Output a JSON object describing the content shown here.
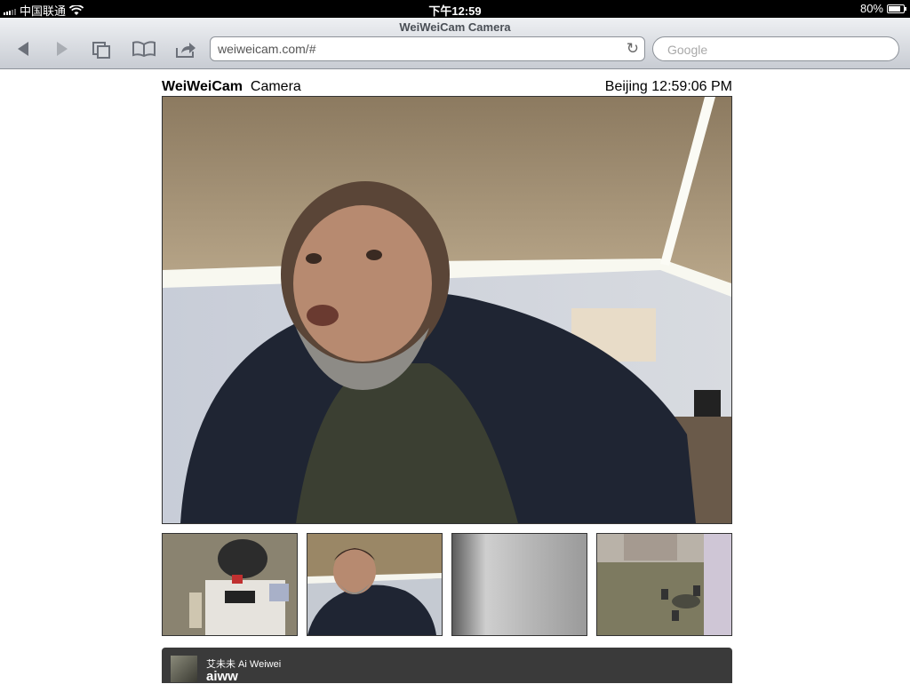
{
  "status_bar": {
    "carrier": "中国联通",
    "time": "下午12:59",
    "battery": "80%",
    "battery_level": 0.8
  },
  "browser": {
    "page_title": "WeiWeiCam Camera",
    "url": "weiweicam.com/#",
    "search_placeholder": "Google"
  },
  "page": {
    "brand": "WeiWeiCam",
    "subtitle": "Camera",
    "clock": "Beijing 12:59:06 PM"
  },
  "thumbnails": [
    {
      "name": "camera-thumb-desk"
    },
    {
      "name": "camera-thumb-portrait"
    },
    {
      "name": "camera-thumb-wall"
    },
    {
      "name": "camera-thumb-courtyard"
    }
  ],
  "footer": {
    "display_name": "艾未未 Ai Weiwei",
    "handle": "aiww"
  }
}
